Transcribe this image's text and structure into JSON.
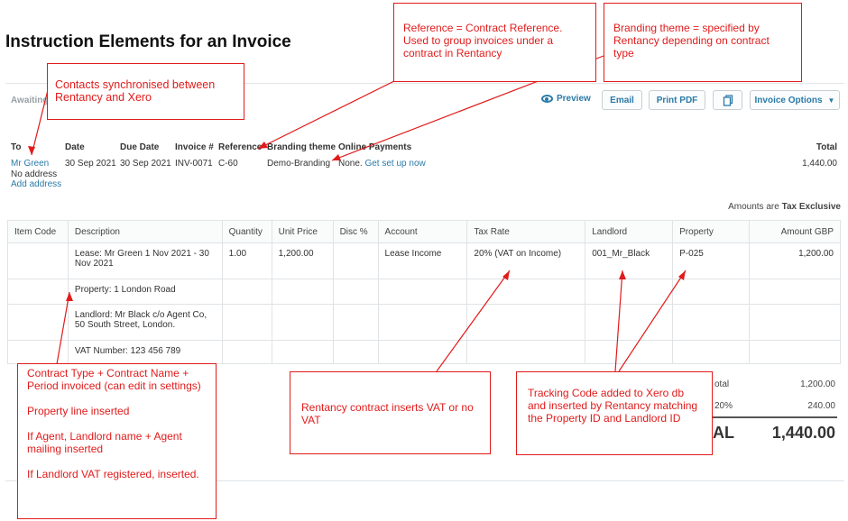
{
  "page_title": "Instruction Elements for an Invoice",
  "invoice": {
    "status": "Awaiting",
    "preview_label": "Preview",
    "buttons": {
      "email": "Email",
      "print_pdf": "Print PDF",
      "options": "Invoice Options"
    },
    "headers": {
      "to": "To",
      "date": "Date",
      "due_date": "Due Date",
      "invoice_no": "Invoice #",
      "reference": "Reference",
      "branding": "Branding theme",
      "online_payments": "Online Payments",
      "total": "Total"
    },
    "values": {
      "contact": "Mr Green",
      "no_address": "No address",
      "add_address": "Add address",
      "date": "30 Sep 2021",
      "due_date": "30 Sep 2021",
      "invoice_no": "INV-0071",
      "reference": "C-60",
      "branding": "Demo-Branding",
      "online_payments": "None.",
      "get_set_up": "Get set up now",
      "total": "1,440.00"
    },
    "amounts_note": "Amounts are",
    "amounts_type": "Tax Exclusive",
    "columns": [
      "Item Code",
      "Description",
      "Quantity",
      "Unit Price",
      "Disc %",
      "Account",
      "Tax Rate",
      "Landlord",
      "Property",
      "Amount GBP"
    ],
    "rows": [
      {
        "description": "Lease: Mr Green 1 Nov 2021 - 30 Nov 2021",
        "quantity": "1.00",
        "unit_price": "1,200.00",
        "account": "Lease Income",
        "tax_rate": "20% (VAT on Income)",
        "landlord": "001_Mr_Black",
        "property": "P-025",
        "amount": "1,200.00"
      },
      {
        "description": "Property: 1 London Road"
      },
      {
        "description": "Landlord: Mr Black c/o Agent Co, 50 South Street, London."
      },
      {
        "description": "VAT Number: 123 456 789"
      }
    ],
    "totals": {
      "subtotal_label": "otal",
      "subtotal": "1,200.00",
      "vat_label": "20%",
      "vat": "240.00",
      "total_label": "AL",
      "total": "1,440.00"
    }
  },
  "annotations": {
    "contacts": "Contacts synchronised between Rentancy and Xero",
    "reference": "Reference = Contract Reference. Used to group invoices under a contract in Rentancy",
    "branding": "Branding theme = specified by Rentancy depending on contract type",
    "contract_lines": [
      "Contract Type + Contract Name + Period invoiced (can edit in settings)",
      "Property line inserted",
      "If Agent, Landlord name + Agent mailing inserted",
      "If Landlord VAT registered, inserted."
    ],
    "vat": "Rentancy contract inserts VAT or no VAT",
    "tracking": "Tracking Code added to Xero db and inserted by Rentancy matching the Property ID and Landlord ID"
  },
  "colors": {
    "annotation": "#e11b1b",
    "link": "#2a7aa8"
  }
}
